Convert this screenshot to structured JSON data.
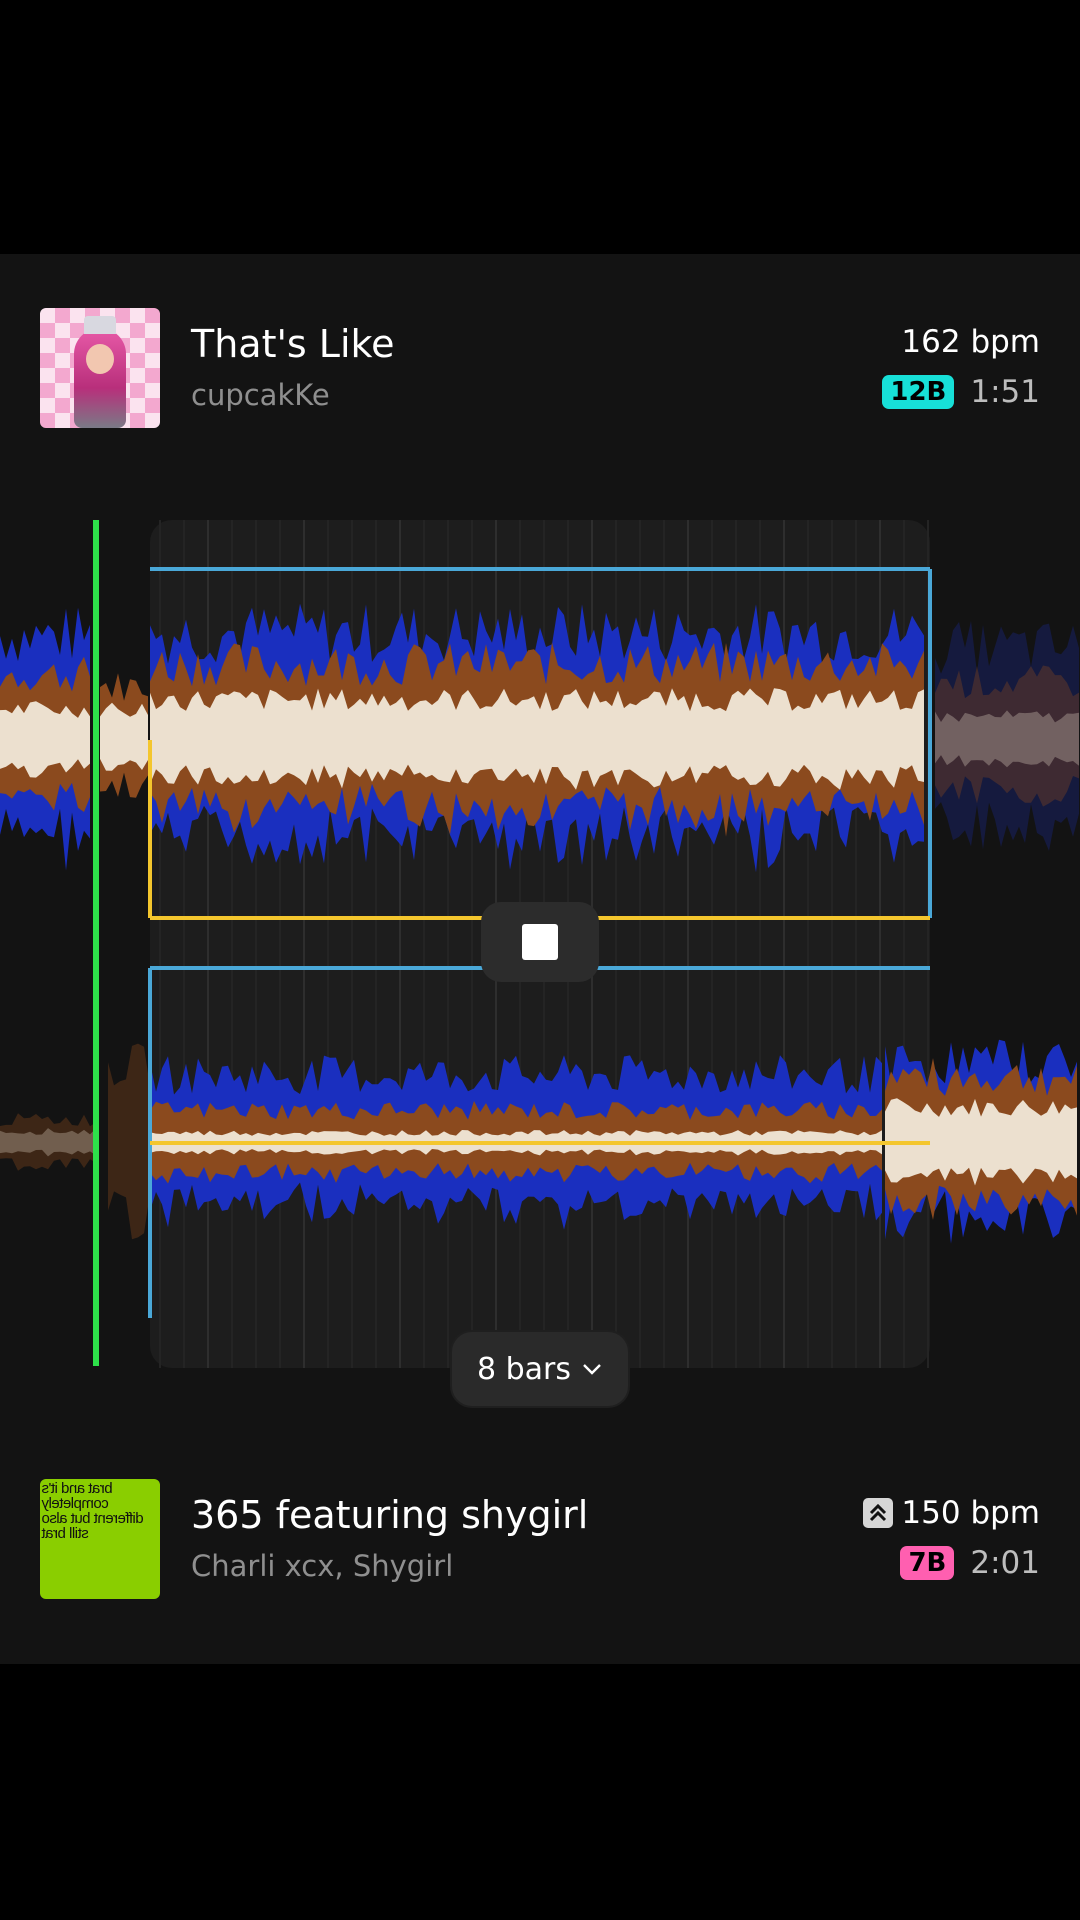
{
  "track_a": {
    "title": "That's Like",
    "artist": "cupcakKe",
    "bpm": "162 bpm",
    "key": "12B",
    "key_color": "#17e0d8",
    "duration": "1:51",
    "artwork_icon": "album-art-pink-checker"
  },
  "track_b": {
    "title": "365 featuring shygirl",
    "artist": "Charli xcx, Shygirl",
    "bpm": "150 bpm",
    "key": "7B",
    "key_color": "#ff5fb0",
    "duration": "2:01",
    "artwork_text": "brat and it's completely different but also still brat",
    "artwork_color": "#8ace00",
    "tempo_icon": "double-chevron-up-icon"
  },
  "transition": {
    "length_label": "8 bars",
    "stop_icon": "stop-icon",
    "dropdown_icon": "chevron-down-icon"
  },
  "colors": {
    "playhead": "#2ee04a",
    "loop_blue": "#4aa8d8",
    "loop_yellow": "#f4c62d",
    "wave_low": "#1a2fbf",
    "wave_mid": "#8b4a1e",
    "wave_high": "#ece0cf"
  }
}
